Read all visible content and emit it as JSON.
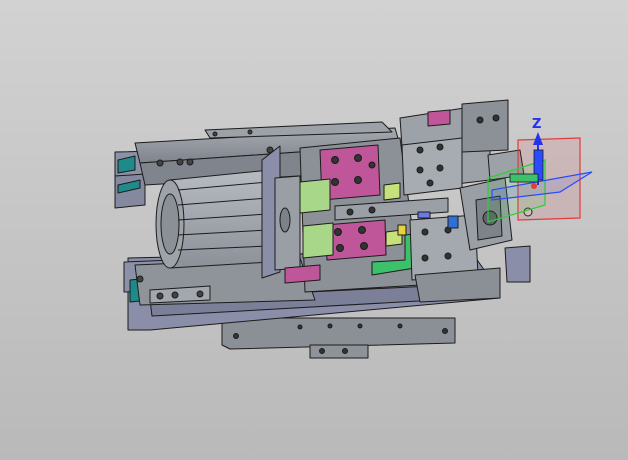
{
  "viewport": {
    "background_top": "#d2d2d2",
    "background_bottom": "#b9b9b9"
  },
  "model": {
    "part_colors": {
      "body": "#8f939a",
      "body_light": "#a9adb4",
      "body_dark": "#6c7078",
      "slide_blue": "#8a8ea8",
      "block_pink": "#c0569a",
      "pad_green": "#a8d78a",
      "teal": "#1f8a8a",
      "bracket_green": "#3cc06a",
      "accent_blue": "#2f6fd6",
      "accent_yellow": "#e6d23a"
    }
  },
  "triad": {
    "z_label": "Z",
    "z_color": "#2233ee",
    "plane_red": "#e23b3b",
    "plane_green": "#2fcf3a",
    "plane_blue": "#2a4bff"
  }
}
